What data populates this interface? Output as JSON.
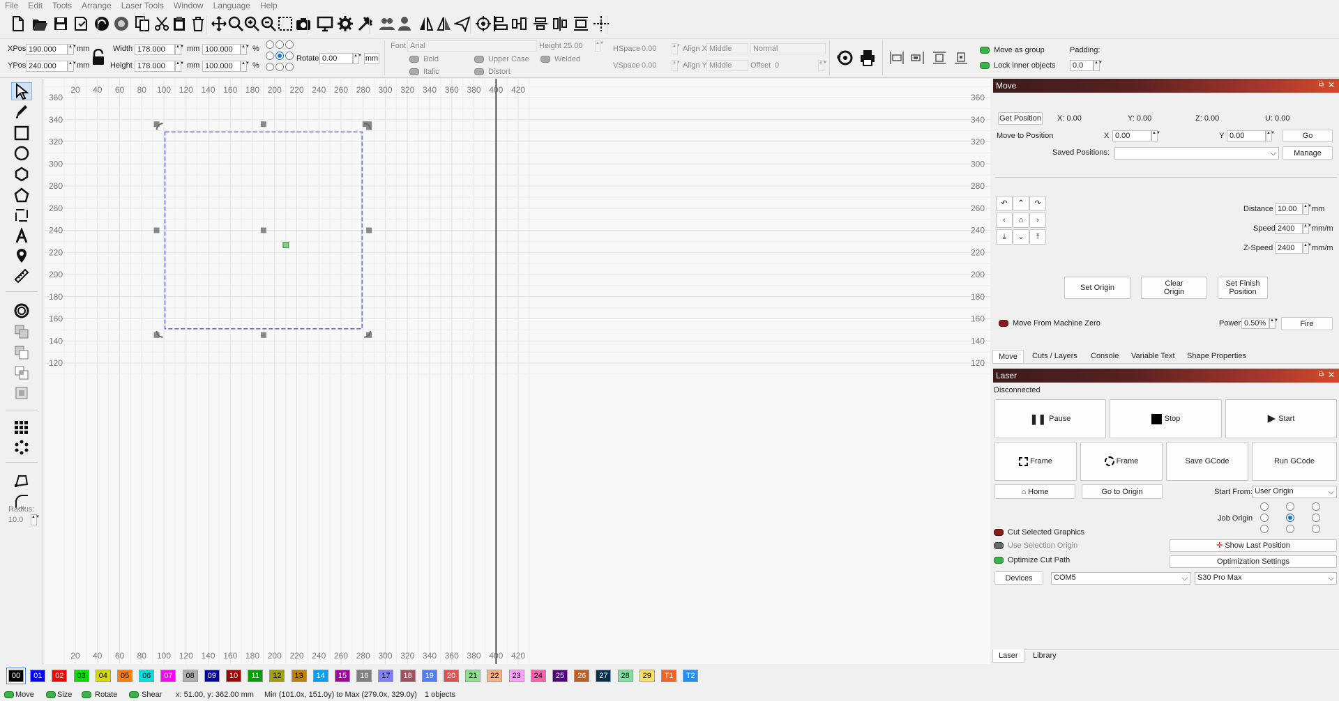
{
  "menu": [
    "File",
    "Edit",
    "Tools",
    "Arrange",
    "Laser Tools",
    "Window",
    "Language",
    "Help"
  ],
  "toolbar_icons": [
    "new-file-icon",
    "open-icon",
    "save-icon",
    "save-as-icon",
    "import-icon",
    "export-icon",
    "copy-icon",
    "cut-icon",
    "paste-icon",
    "delete-icon",
    "move-icon",
    "zoom-icon",
    "zoom-in-icon",
    "zoom-out-icon",
    "zoom-frame-icon",
    "camera-icon",
    "monitor-icon",
    "settings-icon",
    "tools-icon",
    "users-icon",
    "user-icon",
    "mirror-h-icon",
    "mirror-v-icon",
    "send-icon",
    "target-icon",
    "align-icon",
    "distribute-icon",
    "align-center-icon",
    "distribute-v-icon",
    "align-v-icon",
    "crosshair-icon"
  ],
  "props": {
    "xpos_label": "XPos",
    "xpos": "190.000",
    "ypos_label": "YPos",
    "ypos": "240.000",
    "unit_mm": "mm",
    "width_label": "Width",
    "width": "178.000",
    "height_label": "Height",
    "height": "178.000",
    "wpct": "100.000",
    "hpct": "100.000",
    "pct": "%",
    "rotate_label": "Rotate",
    "rotate": "0.00",
    "font_label": "Font",
    "font": "Arial",
    "fheight_label": "Height",
    "fheight": "25.00",
    "hspace_label": "HSpace",
    "hspace": "0.00",
    "vspace_label": "VSpace",
    "vspace": "0.00",
    "alignx_label": "Align X",
    "alignx": "Middle",
    "aligny_label": "Align Y",
    "aligny": "Middle",
    "style": "Normal",
    "offset_label": "Offset",
    "offset": "0",
    "bold": "Bold",
    "italic": "Italic",
    "upper": "Upper Case",
    "distort": "Distort",
    "welded": "Welded",
    "move_group": "Move as group",
    "lock_inner": "Lock inner objects",
    "padding_label": "Padding:",
    "padding": "0.0"
  },
  "ruler_x": [
    "20",
    "40",
    "60",
    "80",
    "100",
    "120",
    "140",
    "160",
    "180",
    "200",
    "220",
    "240",
    "260",
    "280",
    "300",
    "320",
    "340",
    "360",
    "380",
    "400",
    "420"
  ],
  "ruler_y": [
    "360",
    "340",
    "320",
    "300",
    "280",
    "260",
    "240",
    "220",
    "200",
    "180",
    "160",
    "140",
    "120"
  ],
  "radius_label": "Radius:",
  "radius": "10.0",
  "move_panel": {
    "title": "Move",
    "get_position": "Get Position",
    "x": "X: 0.00",
    "y": "Y: 0.00",
    "z": "Z: 0.00",
    "u": "U: 0.00",
    "move_to": "Move to Position",
    "x_lbl": "X",
    "x_val": "0.00",
    "y_lbl": "Y",
    "y_val": "0.00",
    "go": "Go",
    "saved": "Saved Positions:",
    "manage": "Manage",
    "distance_label": "Distance",
    "distance": "10.00",
    "distance_unit": "mm",
    "speed_label": "Speed",
    "speed": "2400",
    "speed_unit": "mm/m",
    "zspeed_label": "Z-Speed",
    "zspeed": "2400",
    "zspeed_unit": "mm/m",
    "set_origin": "Set Origin",
    "clear_origin": "Clear Origin",
    "set_finish": "Set Finish Position",
    "machine_zero": "Move From Machine Zero",
    "power_label": "Power",
    "power": "0.50%",
    "fire": "Fire"
  },
  "mid_tabs": [
    "Move",
    "Cuts / Layers",
    "Console",
    "Variable Text",
    "Shape Properties"
  ],
  "laser_panel": {
    "title": "Laser",
    "status": "Disconnected",
    "pause": "Pause",
    "stop": "Stop",
    "start": "Start",
    "frame1": "Frame",
    "frame2": "Frame",
    "save_gcode": "Save GCode",
    "run_gcode": "Run GCode",
    "home": "Home",
    "goto_origin": "Go to Origin",
    "start_from_label": "Start From:",
    "start_from": "User Origin",
    "job_origin": "Job Origin",
    "cut_selected": "Cut Selected Graphics",
    "use_sel_origin": "Use Selection Origin",
    "show_last": "Show Last Position",
    "optimize": "Optimize Cut Path",
    "opt_settings": "Optimization Settings",
    "devices": "Devices",
    "port": "COM5",
    "device": "S30 Pro Max"
  },
  "bottom_tabs": [
    "Laser",
    "Library"
  ],
  "palette": [
    {
      "t": "00",
      "c": "#000000",
      "f": "#ffffff"
    },
    {
      "t": "01",
      "c": "#0000ff",
      "f": "#ffffff"
    },
    {
      "t": "02",
      "c": "#ff0000",
      "f": "#ffffff"
    },
    {
      "t": "03",
      "c": "#00e000",
      "f": "#000000"
    },
    {
      "t": "04",
      "c": "#d8d800",
      "f": "#000000"
    },
    {
      "t": "05",
      "c": "#ff8000",
      "f": "#000000"
    },
    {
      "t": "06",
      "c": "#00e0e0",
      "f": "#000000"
    },
    {
      "t": "07",
      "c": "#ff00ff",
      "f": "#ffffff"
    },
    {
      "t": "08",
      "c": "#b0b0b0",
      "f": "#000000"
    },
    {
      "t": "09",
      "c": "#0000a0",
      "f": "#ffffff"
    },
    {
      "t": "10",
      "c": "#a00000",
      "f": "#ffffff"
    },
    {
      "t": "11",
      "c": "#00a000",
      "f": "#ffffff"
    },
    {
      "t": "12",
      "c": "#a0a000",
      "f": "#000000"
    },
    {
      "t": "13",
      "c": "#c08000",
      "f": "#000000"
    },
    {
      "t": "14",
      "c": "#00a0ff",
      "f": "#ffffff"
    },
    {
      "t": "15",
      "c": "#a000a0",
      "f": "#ffffff"
    },
    {
      "t": "16",
      "c": "#808080",
      "f": "#ffffff"
    },
    {
      "t": "17",
      "c": "#7f7fff",
      "f": "#000000"
    },
    {
      "t": "18",
      "c": "#a05060",
      "f": "#ffffff"
    },
    {
      "t": "19",
      "c": "#5080ff",
      "f": "#ffffff"
    },
    {
      "t": "20",
      "c": "#e05050",
      "f": "#ffffff"
    },
    {
      "t": "21",
      "c": "#90e090",
      "f": "#000000"
    },
    {
      "t": "22",
      "c": "#ffb080",
      "f": "#000000"
    },
    {
      "t": "23",
      "c": "#ffa0ff",
      "f": "#000000"
    },
    {
      "t": "24",
      "c": "#ff60b0",
      "f": "#000000"
    },
    {
      "t": "25",
      "c": "#500080",
      "f": "#ffffff"
    },
    {
      "t": "26",
      "c": "#c06020",
      "f": "#ffffff"
    },
    {
      "t": "27",
      "c": "#003050",
      "f": "#ffffff"
    },
    {
      "t": "28",
      "c": "#80e0a0",
      "f": "#000000"
    },
    {
      "t": "29",
      "c": "#ffe060",
      "f": "#000000"
    },
    {
      "t": "T1",
      "c": "#ff6020",
      "f": "#ffffff"
    },
    {
      "t": "T2",
      "c": "#2090ff",
      "f": "#ffffff"
    }
  ],
  "status": {
    "move": "Move",
    "size": "Size",
    "rotate": "Rotate",
    "shear": "Shear",
    "coords": "x: 51.00, y: 362.00 mm",
    "minmax": "Min (101.0x, 151.0y) to Max (279.0x, 329.0y)",
    "objects": "1 objects"
  }
}
